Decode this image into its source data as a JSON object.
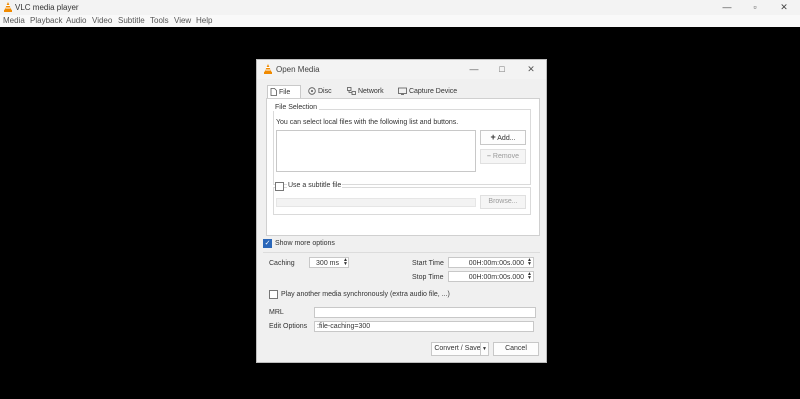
{
  "app": {
    "title": "VLC media player",
    "minimize": "—",
    "maximize": "▫",
    "close": "✕"
  },
  "menu": [
    "Media",
    "Playback",
    "Audio",
    "Video",
    "Subtitle",
    "Tools",
    "View",
    "Help"
  ],
  "dialog": {
    "title": "Open Media",
    "minimize": "—",
    "maximize": "□",
    "close": "✕",
    "tabs": [
      "File",
      "Disc",
      "Network",
      "Capture Device"
    ],
    "file_selection": {
      "legend": "File Selection",
      "description": "You can select local files with the following list and buttons.",
      "add_label": "Add...",
      "remove_label": "Remove"
    },
    "subtitle": {
      "checkbox_label": "Use a subtitle file",
      "browse_label": "Browse..."
    },
    "show_more_options_label": "Show more options",
    "caching": {
      "label": "Caching",
      "value": "300 ms"
    },
    "start_time": {
      "label": "Start Time",
      "value": "00H:00m:00s.000"
    },
    "stop_time": {
      "label": "Stop Time",
      "value": "00H:00m:00s.000"
    },
    "play_another_label": "Play another media synchronously (extra audio file, ...)",
    "mrl": {
      "label": "MRL",
      "value": ""
    },
    "edit_options": {
      "label": "Edit Options",
      "value": ":file-caching=300"
    },
    "convert_save_label": "Convert / Save",
    "cancel_label": "Cancel"
  }
}
